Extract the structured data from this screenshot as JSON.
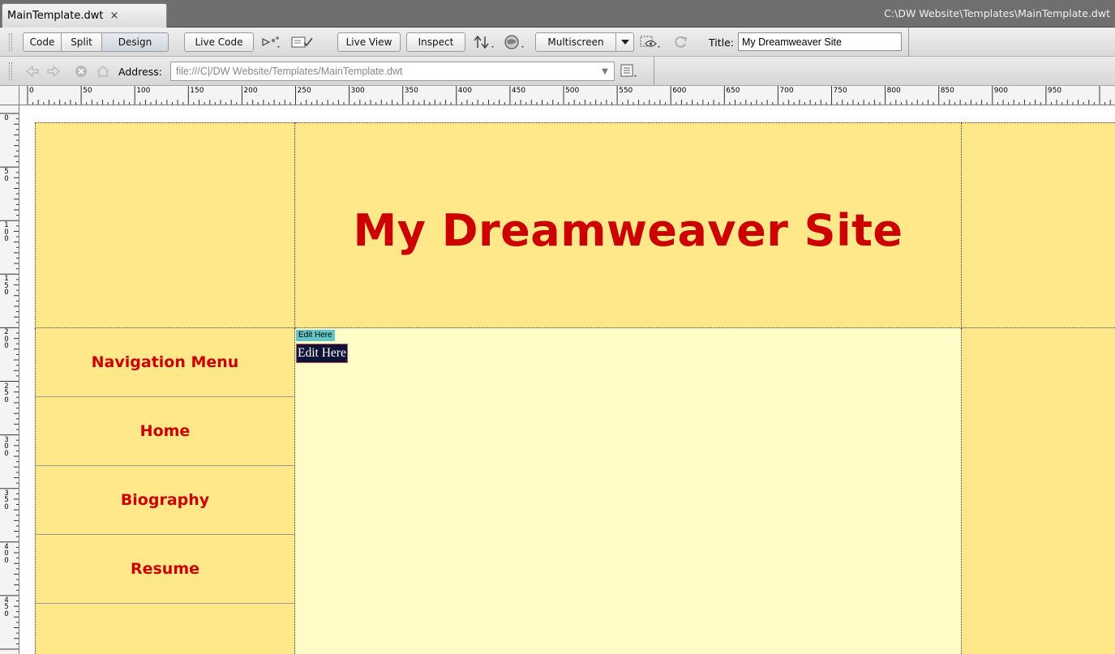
{
  "tab": {
    "filename": "MainTemplate.dwt",
    "close_glyph": "×",
    "path": "C:\\DW Website\\Templates\\MainTemplate.dwt"
  },
  "toolbar": {
    "view_buttons": [
      "Code",
      "Split",
      "Design"
    ],
    "active_view": "Design",
    "live_code": "Live Code",
    "live_view": "Live View",
    "inspect": "Inspect",
    "multiscreen": "Multiscreen",
    "title_label": "Title:",
    "title_value": "My Dreamweaver Site",
    "icons": [
      "code-navigator-icon",
      "visual-aids-icon",
      "file-management-icon",
      "preview-browser-icon",
      "multiscreen-dropdown-icon",
      "visual-aids-eye-icon",
      "refresh-icon"
    ]
  },
  "addressbar": {
    "label": "Address:",
    "value": "file:///C|/DW Website/Templates/MainTemplate.dwt",
    "icons": [
      "back-icon",
      "forward-icon",
      "stop-icon",
      "home-icon",
      "browser-options-icon"
    ]
  },
  "rulers": {
    "horizontal": [
      "0",
      "50",
      "100",
      "150",
      "200",
      "250",
      "300",
      "350",
      "400",
      "450",
      "500",
      "550",
      "600",
      "650",
      "700",
      "750",
      "800",
      "850",
      "900",
      "950"
    ],
    "vertical": [
      "0",
      "50",
      "100",
      "150",
      "200",
      "250",
      "300",
      "350",
      "400",
      "450"
    ]
  },
  "page": {
    "site_title": "My Dreamweaver Site",
    "nav_items": [
      "Navigation Menu",
      "Home",
      "Biography",
      "Resume"
    ],
    "editable_region_tag": "Edit Here",
    "editable_region_text": "Edit Here"
  },
  "colors": {
    "header_bg": "#ffe88a",
    "content_bg": "#fffcc8",
    "title_red": "#cc0000",
    "edit_tag_bg": "#63c5c8",
    "edit_text_bg": "#101338"
  }
}
